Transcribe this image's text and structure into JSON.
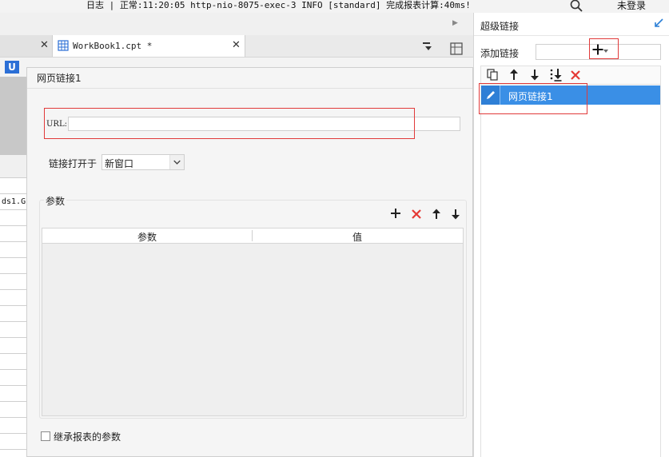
{
  "statusbar": {
    "text": "日志 | 正常:11:20:05 http-nio-8075-exec-3 INFO [standard] 完成报表计算:40ms!",
    "login_label": "未登录"
  },
  "editor": {
    "active_tab_label": "WorkBook1.cpt *",
    "underline_glyph": "U",
    "cell_text": "ds1.G"
  },
  "dialog": {
    "title": "网页链接1",
    "url_label": "URL:",
    "url_value": "",
    "open_in_label": "链接打开于",
    "open_in_value": "新窗口",
    "params_label": "参数",
    "table_headers": [
      "参数",
      "值"
    ],
    "inherit_label": "继承报表的参数"
  },
  "hyperlink_panel": {
    "title": "超级链接",
    "add_link_label": "添加链接",
    "items": [
      {
        "label": "网页链接1",
        "selected": true
      }
    ]
  },
  "colors": {
    "accent": "#3a8fe6",
    "highlight": "#e13a3a",
    "delete": "#e53935"
  },
  "icons": [
    "search-icon",
    "grid-icon",
    "pin-icon",
    "plus-icon",
    "delete-icon",
    "arrow-up-icon",
    "arrow-down-icon",
    "copy-icon",
    "move-bottom-icon",
    "pencil-icon",
    "expand-icon"
  ]
}
